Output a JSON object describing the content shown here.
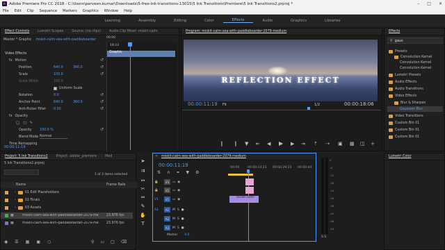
{
  "titlebar": {
    "title": "Adobe Premiere Pro CC 2018 - C:\\Users\\parveen.kumar\\Downloads\\5-free-ink-transitions-13015\\5 Ink Transitions\\Premiere\\5 Ink Transitions2.prproj *",
    "logo": "Pr"
  },
  "menu": [
    "File",
    "Edit",
    "Clip",
    "Sequence",
    "Markers",
    "Graphics",
    "Window",
    "Help"
  ],
  "workspaces": [
    "Learning",
    "Assembly",
    "Editing",
    "Color",
    "Effects",
    "Audio",
    "Graphics",
    "Libraries"
  ],
  "active_workspace": "Effects",
  "effect_controls": {
    "tabs": [
      "Effect Controls",
      "Lumetri Scopes",
      "Source: (no clips)",
      "Audio Clip Mixer: miskit-calm"
    ],
    "master": "Master * Graphic",
    "clip": "miskit-calm-sea-with-paddleboarder",
    "time_start": "00:00",
    "time_ruler": "19:23",
    "clip_bar": "Graphic",
    "video_effects": "Video Effects",
    "motion": "Motion",
    "position_label": "Position",
    "position_x": "640.0",
    "position_y": "360.0",
    "scale_label": "Scale",
    "scale_val": "100.0",
    "scale_width_label": "Scale Width",
    "scale_width_val": "100.0",
    "uniform_label": "Uniform Scale",
    "rotation_label": "Rotation",
    "rotation_val": "0.0",
    "anchor_label": "Anchor Point",
    "anchor_x": "640.0",
    "anchor_y": "360.0",
    "flicker_label": "Anti-flicker Filter",
    "flicker_val": "0.00",
    "opacity_section": "Opacity",
    "opacity_label": "Opacity",
    "opacity_val": "100.0 %",
    "blend_label": "Blend Mode",
    "blend_val": "Normal",
    "time_remap": "Time Remapping",
    "timecode": "00:00:11:19"
  },
  "program": {
    "tab": "Program: miskit-calm-sea-with-paddleboarder-2079-medium",
    "overlay_text": "REFLECTION EFFECT",
    "timecode": "00:00:11:19",
    "fit": "Fit",
    "res": "1/2",
    "duration": "00:00:18:06"
  },
  "project": {
    "tabs": [
      "Project: 5 Ink Transitions2",
      "Project: adobe_premiere",
      "Med"
    ],
    "file": "5 Ink Transitions2.prproj",
    "count": "1 of 3 items selected",
    "col_name": "Name",
    "col_rate": "Frame Rate",
    "items": [
      {
        "name": "01 Edit Placeholders",
        "rate": ""
      },
      {
        "name": "02 Finals",
        "rate": ""
      },
      {
        "name": "03 Assets",
        "rate": ""
      },
      {
        "name": "miskit-calm-sea-with-paddleboarder-2079-me",
        "rate": "23.976 fps"
      },
      {
        "name": "miskit-calm-sea-with-paddleboarder-2079-me",
        "rate": "23.976 fps"
      }
    ]
  },
  "timeline": {
    "tab": "miskit-calm-sea-with-paddleboarder-2079-medium",
    "timecode": "00:00:11:19",
    "ruler": [
      ":00:00",
      "00:00:14:23",
      "00:00:29:23",
      "00:00:44:"
    ],
    "tracks": [
      "V3",
      "V2",
      "V1",
      "A1",
      "A2",
      "A3"
    ],
    "clip": "miskit-calm-",
    "master": "Master",
    "master_val": "0.0"
  },
  "effects": {
    "title": "Effects",
    "search": "gaus",
    "tree": [
      "Presets",
      "Convolution Kernel",
      "Convolution Kernel",
      "Convolution Kernel",
      "Lumetri Presets",
      "Audio Effects",
      "Audio Transitions",
      "Video Effects",
      "Blur & Sharpen",
      "Gaussian Blur",
      "Video Transitions",
      "Custom Bin 01",
      "Custom Bin 01",
      "Custom Bin 01"
    ],
    "lumetri": "Lumetri Color"
  },
  "meter": {
    "labels": [
      "0",
      "-6",
      "-12",
      "-18",
      "-24",
      "-30",
      "-36",
      "-42",
      "-48",
      "-54"
    ],
    "footer": "S S"
  }
}
